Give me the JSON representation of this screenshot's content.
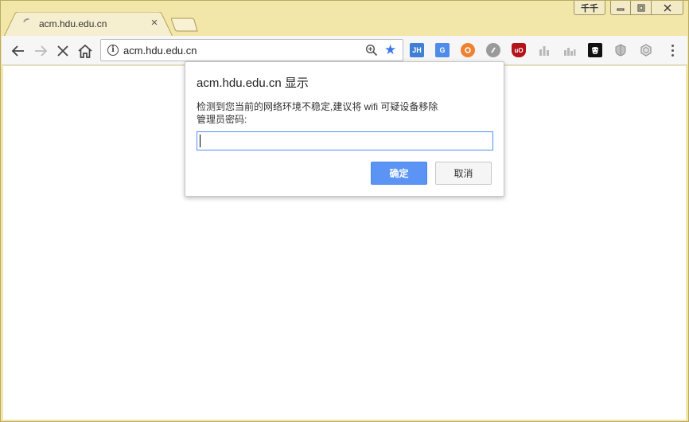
{
  "tab": {
    "title": "acm.hdu.edu.cn"
  },
  "window_controls": {
    "ext_label": "千千"
  },
  "address_bar": {
    "url": "acm.hdu.edu.cn"
  },
  "extensions": [
    {
      "name": "jh-extension-icon",
      "label": "JH",
      "color": "#3f7fd6"
    },
    {
      "name": "google-translate-icon",
      "label": "G",
      "color": "#4f8bea"
    },
    {
      "name": "orange-extension-icon",
      "label": "",
      "color": "#f08131"
    },
    {
      "name": "gray-circle-extension-icon",
      "label": "",
      "color": "#9a9a9a"
    },
    {
      "name": "ublock-icon",
      "label": "uO",
      "color": "#b5131a"
    },
    {
      "name": "bars-extension-icon-1",
      "label": "",
      "color": "#b8b8b8"
    },
    {
      "name": "bars-extension-icon-2",
      "label": "",
      "color": "#b8b8b8"
    },
    {
      "name": "mask-extension-icon",
      "label": "",
      "color": "#111111"
    },
    {
      "name": "gray-shield-extension-icon",
      "label": "",
      "color": "#a6a6a6"
    },
    {
      "name": "hex-extension-icon",
      "label": "",
      "color": "#8f8f8f"
    }
  ],
  "dialog": {
    "title": "acm.hdu.edu.cn 显示",
    "message_line1": "检测到您当前的网络环境不稳定,建议将 wifi 可疑设备移除",
    "message_line2": "管理员密码:",
    "input_value": "",
    "ok_label": "确定",
    "cancel_label": "取消"
  },
  "colors": {
    "frame": "#f2e6a8",
    "accent": "#5c94f5",
    "star": "#3b78e7"
  }
}
